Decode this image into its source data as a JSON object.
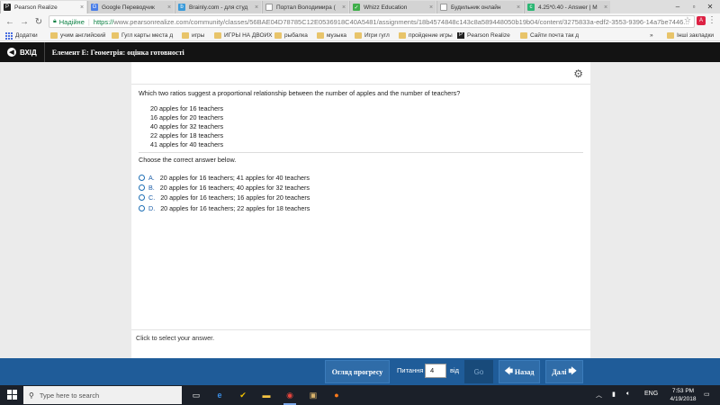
{
  "browser": {
    "tabs": [
      {
        "title": "Pearson Realize",
        "icon": "pearson-icon",
        "active": true
      },
      {
        "title": "Google Переводчик",
        "icon": "google-translate-icon",
        "active": false
      },
      {
        "title": "Brainly.com - для студ",
        "icon": "brainly-icon",
        "active": false
      },
      {
        "title": "Портал Володимира (",
        "icon": "page-icon",
        "active": false
      },
      {
        "title": "Whizz Education",
        "icon": "whizz-icon",
        "active": false
      },
      {
        "title": "Будильник онлайн",
        "icon": "page-icon",
        "active": false
      },
      {
        "title": "4.25*0.40 - Answer | M",
        "icon": "mathway-icon",
        "active": false
      }
    ],
    "secure_label": "Надійне",
    "url_https": "https://",
    "url_rest": "www.pearsonrealize.com/community/classes/56BAE04D78785C12E0536918C40A5481/assignments/18b4574848c143c8a589448050b19b04/content/3275833a-edf2-3553-9396-14a7be7446...",
    "bookmarks": [
      "Додатки",
      "учим английский",
      "Гугл карты места д",
      "игры",
      "ИГРЫ НА ДВОИХ",
      "рыбалка",
      "музыка",
      "Игри гугл",
      "пройдение игры",
      "Pearson Realize",
      "Сайти почта так д"
    ],
    "bookmarks_more": "»",
    "other_bookmarks": "Інші закладки"
  },
  "header": {
    "back_label": "ВХІД",
    "title": "Елемент Е: Геометрія: оцінка готовності"
  },
  "question": {
    "prompt": "Which two ratios suggest a proportional relationship between the number of apples and the number of teachers?",
    "ratios": [
      "20 apples for 16 teachers",
      "16 apples for 20 teachers",
      "40 apples for 32 teachers",
      "22 apples for 18 teachers",
      "41 apples for 40 teachers"
    ],
    "instruction": "Choose the correct answer below.",
    "options": [
      {
        "letter": "A.",
        "text": "20 apples for 16 teachers; 41 apples for 40 teachers"
      },
      {
        "letter": "B.",
        "text": "20 apples for 16 teachers; 40 apples for 32 teachers"
      },
      {
        "letter": "C.",
        "text": "20 apples for 16 teachers; 16 apples for 20 teachers"
      },
      {
        "letter": "D.",
        "text": "20 apples for 16 teachers; 22 apples for 18 teachers"
      }
    ],
    "hint": "Click to select your answer."
  },
  "footer": {
    "review_label": "Огляд прогресу",
    "question_label": "Питання",
    "question_number": "4",
    "of_label": "від",
    "go_label": "Go",
    "prev_label": "Назад",
    "next_label": "Далі"
  },
  "taskbar": {
    "search_placeholder": "Type here to search",
    "language": "ENG",
    "time": "7:53 PM",
    "date": "4/19/2018"
  },
  "colors": {
    "header_bg": "#131313",
    "footer_bg": "#1f5c99",
    "link_blue": "#1e5fa8",
    "secure_green": "#0b8043"
  }
}
